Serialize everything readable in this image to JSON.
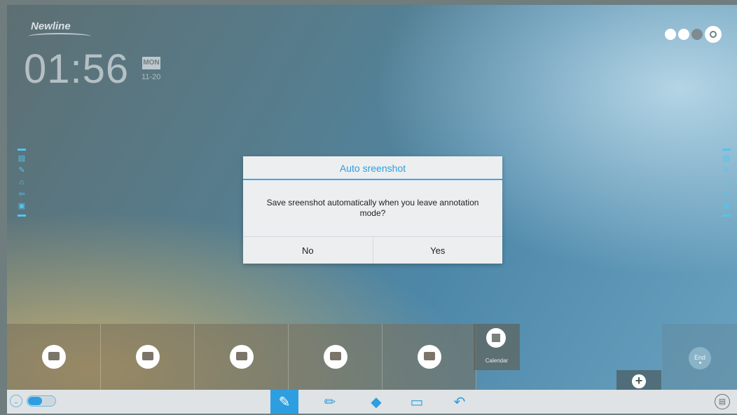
{
  "header": {
    "brand": "Newline",
    "time": "01:56",
    "day": "MON",
    "date": "11-20"
  },
  "status_icons": [
    "mic-icon",
    "lan-icon",
    "wifi-icon",
    "settings-gear-icon"
  ],
  "side_toolbar": {
    "icons": [
      "notes-icon",
      "edit-icon",
      "home-icon",
      "back-icon",
      "display-icon"
    ]
  },
  "dialog": {
    "title": "Auto sreenshot",
    "message": "Save sreenshot automatically when you leave annotation mode?",
    "no_label": "No",
    "yes_label": "Yes"
  },
  "dock": {
    "tiles": [
      "monitor-icon",
      "projector-icon",
      "whiteboard-icon",
      "apps-grid-icon",
      "folder-icon"
    ],
    "calendar_label": "Calendar",
    "end_label": "End"
  },
  "bottom_bar": {
    "tools": [
      "pen-icon",
      "highlighter-icon",
      "eraser-icon",
      "screen-capture-icon",
      "undo-icon"
    ],
    "active_tool": "pen-icon"
  },
  "colors": {
    "accent": "#2d9fe0",
    "side_icon": "#55c3ee"
  }
}
